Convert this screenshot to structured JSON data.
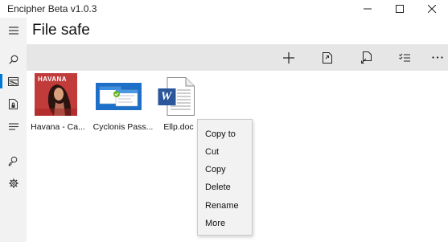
{
  "window": {
    "title": "Encipher  Beta v1.0.3",
    "controls": [
      "minimize-icon",
      "maximize-icon",
      "close-icon"
    ]
  },
  "nav_rail": {
    "items": [
      {
        "icon": "hamburger-menu-icon"
      },
      {
        "icon": "search-icon"
      },
      {
        "icon": "encrypted-drive-icon",
        "active": true
      },
      {
        "icon": "locked-file-icon"
      },
      {
        "icon": "list-icon"
      },
      {
        "icon": "account-key-icon"
      },
      {
        "icon": "settings-icon"
      }
    ],
    "accent": "#0078d7"
  },
  "page": {
    "title": "File safe"
  },
  "command_bar": {
    "buttons": [
      {
        "icon": "add-icon"
      },
      {
        "icon": "import-file-icon"
      },
      {
        "icon": "export-file-icon"
      },
      {
        "icon": "select-all-icon"
      },
      {
        "icon": "more-options-icon"
      }
    ]
  },
  "files": [
    {
      "name": "Havana - Camila Cabello.jpg",
      "display": "Havana - Ca...",
      "thumb": "album-art",
      "thumb_label": "HAVANA"
    },
    {
      "name": "Cyclonis Password Manager",
      "display": "Cyclonis Pass...",
      "thumb": "app-screenshot"
    },
    {
      "name": "Ellp.doc",
      "display": "Ellp.doc",
      "thumb": "word-document-icon",
      "thumb_label": "W"
    }
  ],
  "context_menu": {
    "items": [
      "Copy to",
      "Cut",
      "Copy",
      "Delete",
      "Rename",
      "More"
    ]
  }
}
